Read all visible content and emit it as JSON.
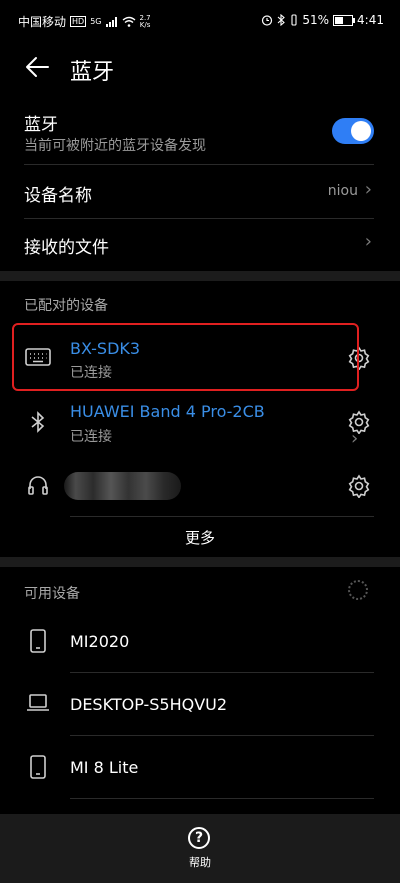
{
  "status_bar": {
    "carrier": "中国移动",
    "network_badge": "HD",
    "signal": "5G",
    "speed_top": "2.7",
    "speed_bottom": "K/s",
    "battery_percent": "51%",
    "battery_level": 0.51,
    "time": "4:41"
  },
  "header": {
    "title": "蓝牙"
  },
  "bluetooth": {
    "label": "蓝牙",
    "subtitle": "当前可被附近的蓝牙设备发现",
    "enabled": true
  },
  "device_name": {
    "label": "设备名称",
    "value": "niou"
  },
  "received_files": {
    "label": "接收的文件"
  },
  "paired_section": {
    "label": "已配对的设备",
    "devices": [
      {
        "name": "BX-SDK3",
        "status": "已连接",
        "icon": "keyboard-icon"
      },
      {
        "name": "HUAWEI Band 4 Pro-2CB",
        "status": "已连接",
        "icon": "bluetooth-icon"
      },
      {
        "name": "",
        "status": "",
        "icon": "headphones-icon"
      }
    ],
    "more": "更多"
  },
  "available_section": {
    "label": "可用设备",
    "devices": [
      {
        "name": "MI2020",
        "icon": "phone-icon"
      },
      {
        "name": "DESKTOP-S5HQVU2",
        "icon": "laptop-icon"
      },
      {
        "name": "MI 8 Lite",
        "icon": "phone-icon"
      }
    ]
  },
  "bottom": {
    "help_glyph": "?",
    "help_label": "帮助"
  },
  "colors": {
    "accent": "#2f7ef5",
    "link": "#3a8ee6",
    "highlight": "#e02020"
  }
}
